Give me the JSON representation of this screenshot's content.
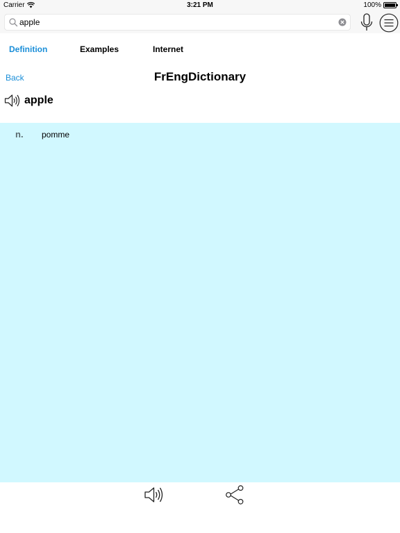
{
  "status_bar": {
    "carrier": "Carrier",
    "time": "3:21 PM",
    "battery_percent": "100%",
    "battery_level": 1.0,
    "wifi_icon": "wifi-icon"
  },
  "search": {
    "value": "apple",
    "search_icon": "search-icon",
    "clear_icon": "clear-icon"
  },
  "toolbar": {
    "mic_icon": "microphone-icon",
    "menu_icon": "menu-icon"
  },
  "tabs": [
    {
      "label": "Definition",
      "active": true
    },
    {
      "label": "Examples",
      "active": false
    },
    {
      "label": "Internet",
      "active": false
    }
  ],
  "header": {
    "back_label": "Back",
    "title": "FrEngDictionary"
  },
  "entry": {
    "word": "apple",
    "speaker_icon": "speaker-icon",
    "definitions": [
      {
        "pos": "n.",
        "meaning": "pomme"
      }
    ]
  },
  "bottom_bar": {
    "speak_icon": "speaker-icon",
    "share_icon": "share-icon"
  },
  "colors": {
    "accent": "#1a8ed8",
    "definition_background": "#d1f8ff"
  }
}
